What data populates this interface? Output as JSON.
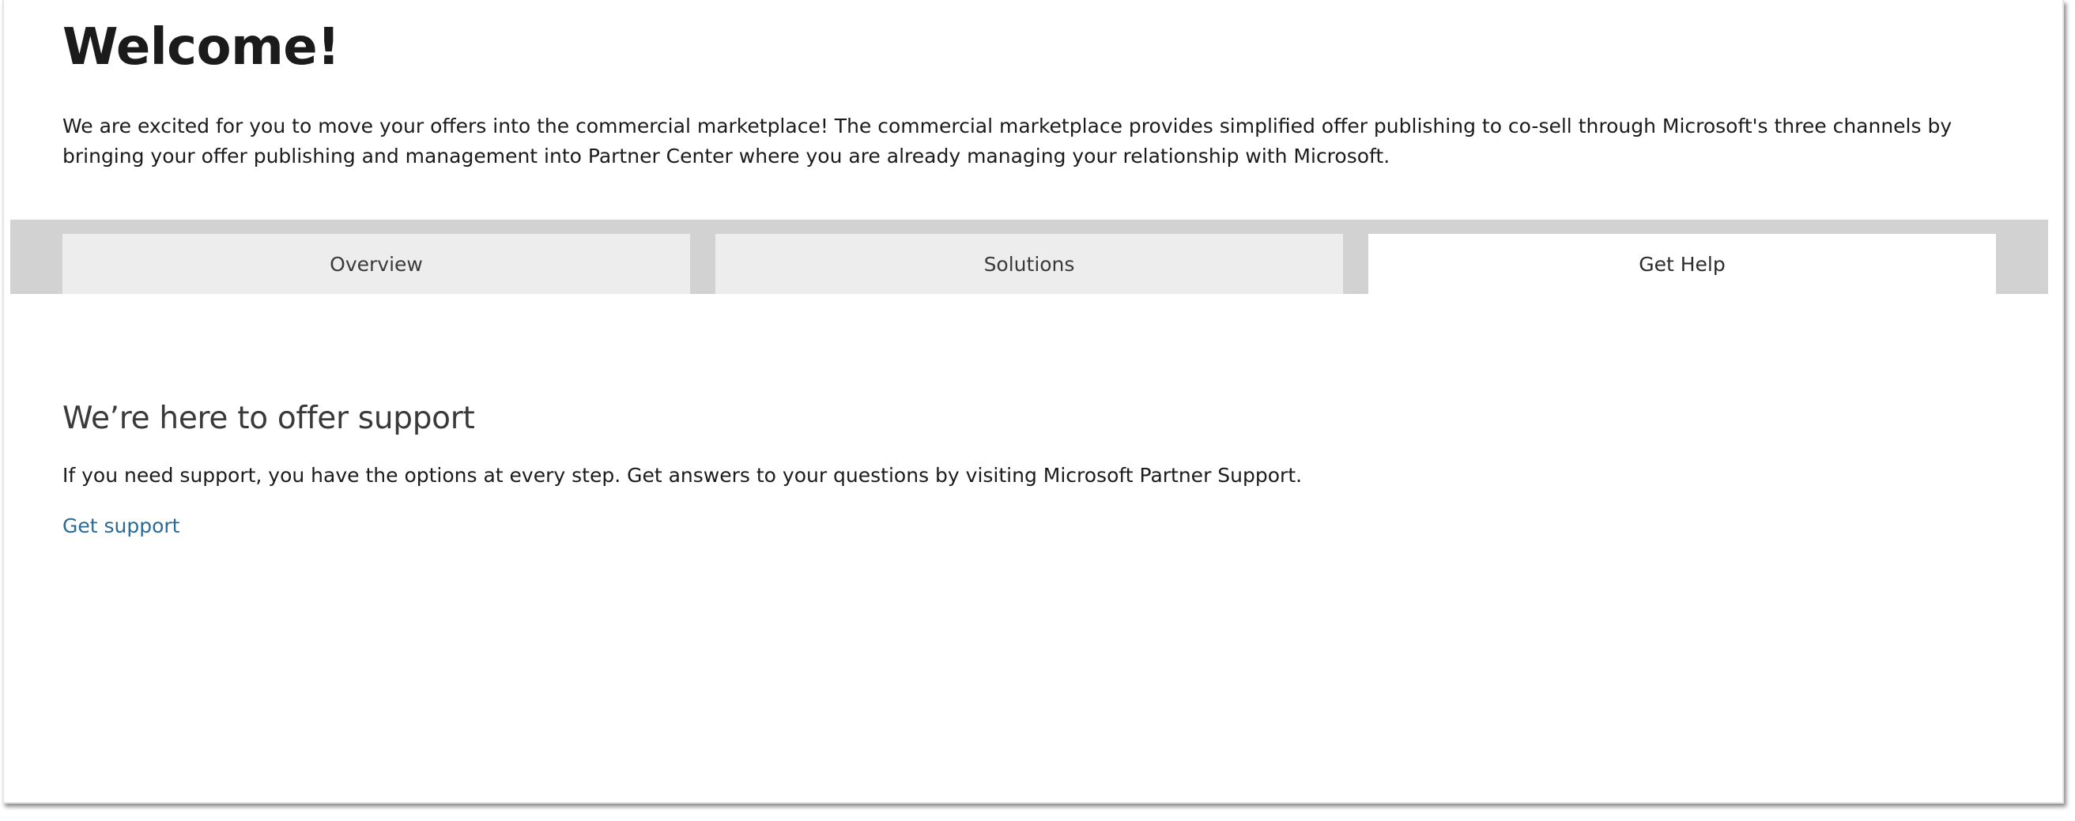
{
  "header": {
    "title": "Welcome!",
    "intro": "We are excited for you to move your offers into the commercial marketplace! The commercial marketplace provides simplified offer publishing to co-sell through Microsoft's three channels by bringing your offer publishing and management into Partner Center where you are already managing your relationship with Microsoft."
  },
  "tabs": [
    {
      "label": "Overview",
      "selected": false
    },
    {
      "label": "Solutions",
      "selected": false
    },
    {
      "label": "Get Help",
      "selected": true
    }
  ],
  "help": {
    "heading": "We’re here to offer support",
    "body": "If you need support, you have the options at every step. Get answers to your questions by visiting Microsoft Partner Support.",
    "link_label": "Get support"
  },
  "colors": {
    "tabbar_background": "#d2d2d2",
    "tab_inactive": "#ededed",
    "tab_active": "#ffffff",
    "link": "#2b6a94"
  }
}
